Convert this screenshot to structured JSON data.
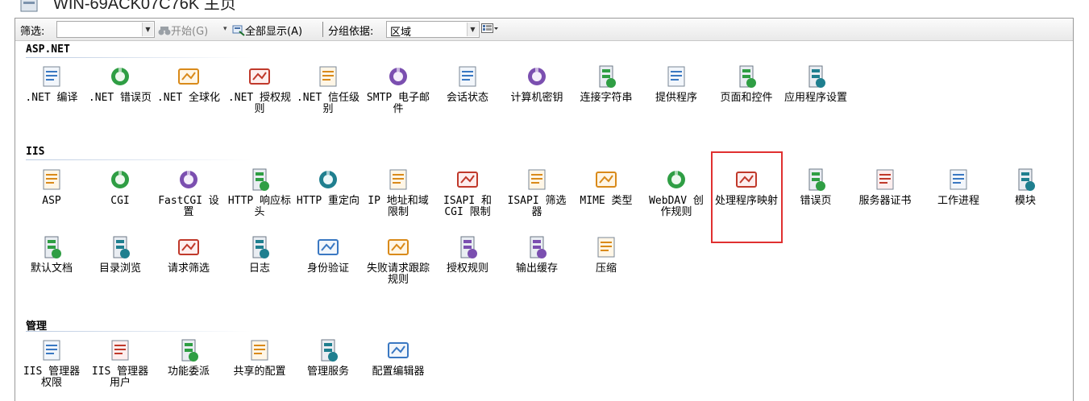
{
  "window": {
    "title": "WIN-69ACK07C76K 主页"
  },
  "toolbar": {
    "filter_label": "筛选:",
    "filter_value": "",
    "start_label": "开始(G)",
    "show_all_label": "全部显示(A)",
    "group_label": "分组依据:",
    "group_value": "区域"
  },
  "sections": [
    {
      "title": "ASP.NET",
      "items": [
        {
          "label": ".NET 编译",
          "icon": "dotnet-compile-icon"
        },
        {
          "label": ".NET 错误页",
          "icon": "dotnet-error-page-icon"
        },
        {
          "label": ".NET 全球化",
          "icon": "dotnet-globalization-icon"
        },
        {
          "label": ".NET 授权规则",
          "icon": "dotnet-authorization-icon"
        },
        {
          "label": ".NET 信任级别",
          "icon": "dotnet-trust-level-icon"
        },
        {
          "label": "SMTP 电子邮件",
          "icon": "smtp-email-icon"
        },
        {
          "label": "会话状态",
          "icon": "session-state-icon"
        },
        {
          "label": "计算机密钥",
          "icon": "machine-key-icon"
        },
        {
          "label": "连接字符串",
          "icon": "connection-strings-icon"
        },
        {
          "label": "提供程序",
          "icon": "providers-icon"
        },
        {
          "label": "页面和控件",
          "icon": "pages-controls-icon"
        },
        {
          "label": "应用程序设置",
          "icon": "app-settings-icon"
        }
      ]
    },
    {
      "title": "IIS",
      "items": [
        {
          "label": "ASP",
          "icon": "asp-icon"
        },
        {
          "label": "CGI",
          "icon": "cgi-icon"
        },
        {
          "label": "FastCGI 设置",
          "icon": "fastcgi-icon"
        },
        {
          "label": "HTTP 响应标头",
          "icon": "http-response-headers-icon"
        },
        {
          "label": "HTTP 重定向",
          "icon": "http-redirect-icon"
        },
        {
          "label": "IP 地址和域限制",
          "icon": "ip-domain-restrictions-icon"
        },
        {
          "label": "ISAPI 和 CGI 限制",
          "icon": "isapi-cgi-restrictions-icon"
        },
        {
          "label": "ISAPI 筛选器",
          "icon": "isapi-filters-icon"
        },
        {
          "label": "MIME 类型",
          "icon": "mime-types-icon"
        },
        {
          "label": "WebDAV 创作规则",
          "icon": "webdav-icon"
        },
        {
          "label": "处理程序映射",
          "icon": "handler-mappings-icon"
        },
        {
          "label": "错误页",
          "icon": "error-pages-icon"
        },
        {
          "label": "服务器证书",
          "icon": "server-certificates-icon"
        },
        {
          "label": "工作进程",
          "icon": "worker-processes-icon"
        },
        {
          "label": "模块",
          "icon": "modules-icon"
        },
        {
          "label": "默认文档",
          "icon": "default-document-icon"
        },
        {
          "label": "目录浏览",
          "icon": "directory-browsing-icon"
        },
        {
          "label": "请求筛选",
          "icon": "request-filtering-icon"
        },
        {
          "label": "日志",
          "icon": "logging-icon"
        },
        {
          "label": "身份验证",
          "icon": "authentication-icon"
        },
        {
          "label": "失败请求跟踪规则",
          "icon": "failed-request-tracing-icon"
        },
        {
          "label": "授权规则",
          "icon": "authorization-rules-icon"
        },
        {
          "label": "输出缓存",
          "icon": "output-caching-icon"
        },
        {
          "label": "压缩",
          "icon": "compression-icon"
        }
      ]
    },
    {
      "title": "管理",
      "items": [
        {
          "label": "IIS 管理器权限",
          "icon": "iis-manager-permissions-icon"
        },
        {
          "label": "IIS 管理器用户",
          "icon": "iis-manager-users-icon"
        },
        {
          "label": "功能委派",
          "icon": "feature-delegation-icon"
        },
        {
          "label": "共享的配置",
          "icon": "shared-configuration-icon"
        },
        {
          "label": "管理服务",
          "icon": "management-service-icon"
        },
        {
          "label": "配置编辑器",
          "icon": "configuration-editor-icon"
        }
      ]
    }
  ]
}
